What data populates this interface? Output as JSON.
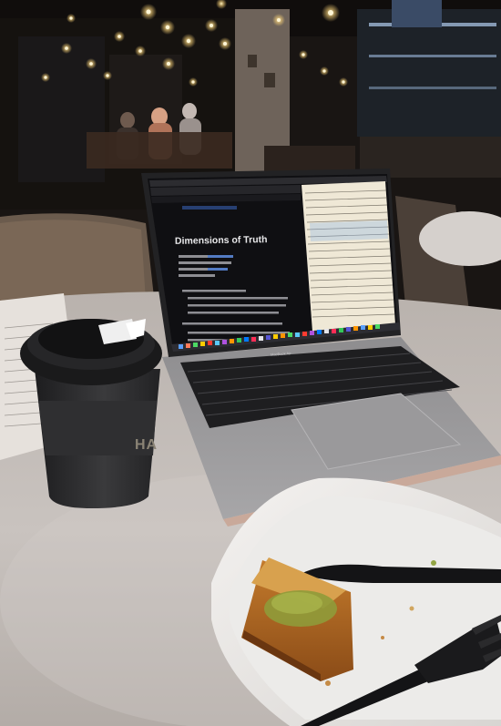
{
  "laptop": {
    "notes_app": {
      "page_title": "Dimensions of Truth"
    },
    "brand_label": "MacBook Air"
  },
  "cup": {
    "brand_text": "HA"
  }
}
